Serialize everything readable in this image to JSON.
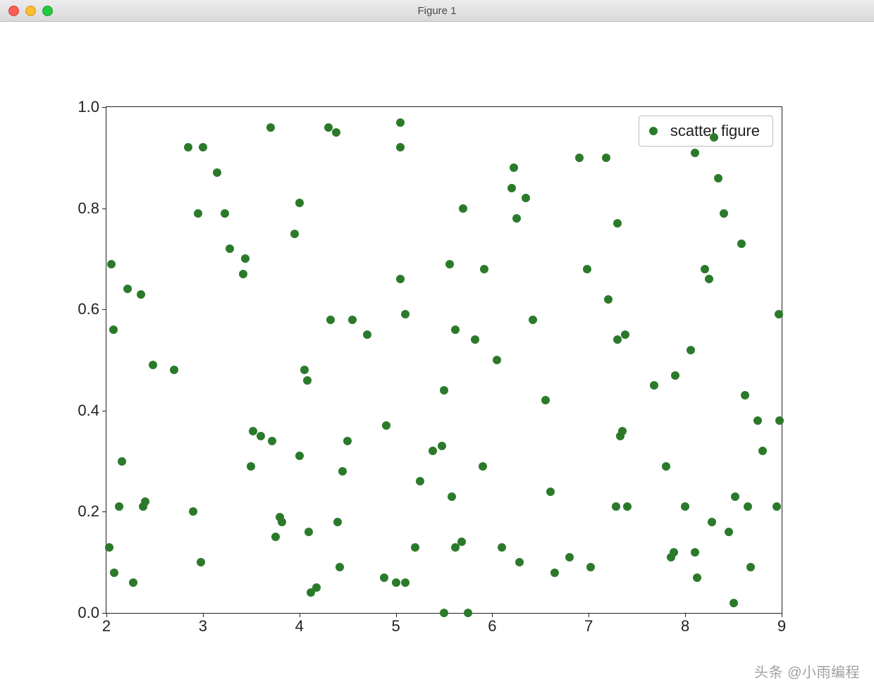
{
  "window": {
    "title": "Figure 1"
  },
  "watermark": "头条 @小雨编程",
  "chart_data": {
    "type": "scatter",
    "legend": [
      "scatter figure"
    ],
    "xlim": [
      2,
      9
    ],
    "ylim": [
      0.0,
      1.0
    ],
    "xticks": [
      2,
      3,
      4,
      5,
      6,
      7,
      8,
      9
    ],
    "yticks": [
      0.0,
      0.2,
      0.4,
      0.6,
      0.8,
      1.0
    ],
    "point_color": "#2b7a2b",
    "series": [
      {
        "name": "scatter figure",
        "points": [
          [
            2.03,
            0.13
          ],
          [
            2.05,
            0.69
          ],
          [
            2.07,
            0.56
          ],
          [
            2.08,
            0.08
          ],
          [
            2.13,
            0.21
          ],
          [
            2.16,
            0.3
          ],
          [
            2.22,
            0.64
          ],
          [
            2.28,
            0.06
          ],
          [
            2.36,
            0.63
          ],
          [
            2.38,
            0.21
          ],
          [
            2.4,
            0.22
          ],
          [
            2.48,
            0.49
          ],
          [
            2.7,
            0.48
          ],
          [
            2.85,
            0.92
          ],
          [
            2.9,
            0.2
          ],
          [
            2.95,
            0.79
          ],
          [
            2.98,
            0.1
          ],
          [
            3.0,
            0.92
          ],
          [
            3.15,
            0.87
          ],
          [
            3.23,
            0.79
          ],
          [
            3.28,
            0.72
          ],
          [
            3.42,
            0.67
          ],
          [
            3.44,
            0.7
          ],
          [
            3.5,
            0.29
          ],
          [
            3.52,
            0.36
          ],
          [
            3.6,
            0.35
          ],
          [
            3.7,
            0.96
          ],
          [
            3.72,
            0.34
          ],
          [
            3.75,
            0.15
          ],
          [
            3.8,
            0.19
          ],
          [
            3.82,
            0.18
          ],
          [
            3.95,
            0.75
          ],
          [
            4.0,
            0.81
          ],
          [
            4.0,
            0.31
          ],
          [
            4.05,
            0.48
          ],
          [
            4.08,
            0.46
          ],
          [
            4.1,
            0.16
          ],
          [
            4.12,
            0.04
          ],
          [
            4.18,
            0.05
          ],
          [
            4.3,
            0.96
          ],
          [
            4.32,
            0.58
          ],
          [
            4.38,
            0.95
          ],
          [
            4.4,
            0.18
          ],
          [
            4.42,
            0.09
          ],
          [
            4.45,
            0.28
          ],
          [
            4.5,
            0.34
          ],
          [
            4.55,
            0.58
          ],
          [
            4.7,
            0.55
          ],
          [
            4.88,
            0.07
          ],
          [
            4.9,
            0.37
          ],
          [
            5.0,
            0.06
          ],
          [
            5.05,
            0.92
          ],
          [
            5.05,
            0.97
          ],
          [
            5.05,
            0.66
          ],
          [
            5.1,
            0.59
          ],
          [
            5.1,
            0.06
          ],
          [
            5.2,
            0.13
          ],
          [
            5.25,
            0.26
          ],
          [
            5.38,
            0.32
          ],
          [
            5.48,
            0.33
          ],
          [
            5.5,
            0.44
          ],
          [
            5.5,
            0.0
          ],
          [
            5.56,
            0.69
          ],
          [
            5.58,
            0.23
          ],
          [
            5.62,
            0.13
          ],
          [
            5.62,
            0.56
          ],
          [
            5.68,
            0.14
          ],
          [
            5.7,
            0.8
          ],
          [
            5.75,
            0.0
          ],
          [
            5.82,
            0.54
          ],
          [
            5.9,
            0.29
          ],
          [
            5.92,
            0.68
          ],
          [
            6.05,
            0.5
          ],
          [
            6.1,
            0.13
          ],
          [
            6.2,
            0.84
          ],
          [
            6.22,
            0.88
          ],
          [
            6.25,
            0.78
          ],
          [
            6.28,
            0.1
          ],
          [
            6.35,
            0.82
          ],
          [
            6.42,
            0.58
          ],
          [
            6.55,
            0.42
          ],
          [
            6.6,
            0.24
          ],
          [
            6.65,
            0.08
          ],
          [
            6.8,
            0.11
          ],
          [
            6.9,
            0.9
          ],
          [
            6.98,
            0.68
          ],
          [
            7.02,
            0.09
          ],
          [
            7.18,
            0.9
          ],
          [
            7.2,
            0.62
          ],
          [
            7.28,
            0.21
          ],
          [
            7.3,
            0.77
          ],
          [
            7.3,
            0.54
          ],
          [
            7.33,
            0.35
          ],
          [
            7.35,
            0.36
          ],
          [
            7.38,
            0.55
          ],
          [
            7.4,
            0.21
          ],
          [
            7.68,
            0.45
          ],
          [
            7.8,
            0.29
          ],
          [
            7.85,
            0.11
          ],
          [
            7.88,
            0.12
          ],
          [
            7.9,
            0.47
          ],
          [
            8.0,
            0.21
          ],
          [
            8.06,
            0.52
          ],
          [
            8.1,
            0.12
          ],
          [
            8.1,
            0.91
          ],
          [
            8.12,
            0.07
          ],
          [
            8.2,
            0.68
          ],
          [
            8.25,
            0.66
          ],
          [
            8.28,
            0.18
          ],
          [
            8.3,
            0.94
          ],
          [
            8.34,
            0.86
          ],
          [
            8.4,
            0.79
          ],
          [
            8.45,
            0.16
          ],
          [
            8.5,
            0.02
          ],
          [
            8.52,
            0.23
          ],
          [
            8.58,
            0.73
          ],
          [
            8.62,
            0.43
          ],
          [
            8.65,
            0.21
          ],
          [
            8.68,
            0.09
          ],
          [
            8.75,
            0.38
          ],
          [
            8.8,
            0.32
          ],
          [
            8.95,
            0.21
          ],
          [
            8.97,
            0.59
          ],
          [
            8.98,
            0.38
          ]
        ]
      }
    ]
  }
}
